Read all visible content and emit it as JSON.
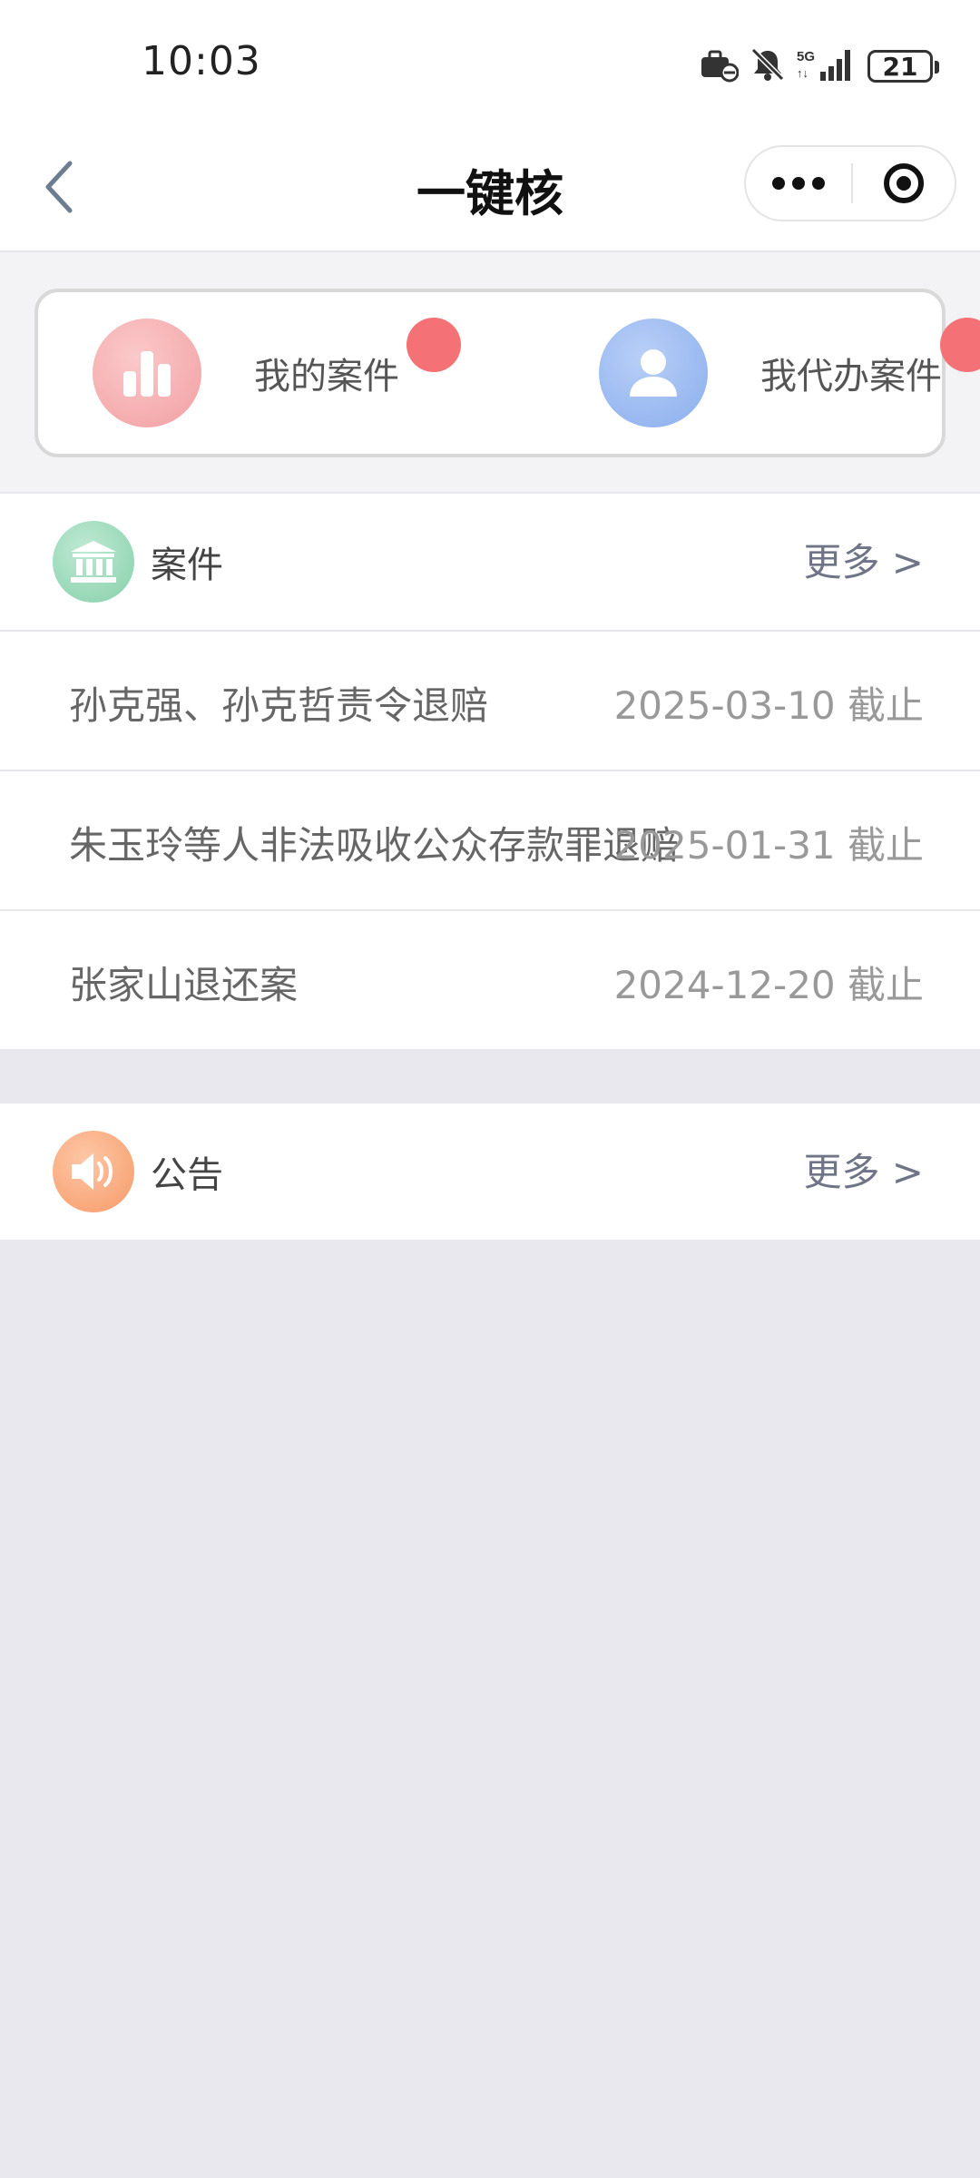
{
  "status": {
    "time": "10:03",
    "battery": "21"
  },
  "nav": {
    "title": "一键核"
  },
  "quick": [
    {
      "label": "我的案件",
      "color": "#f2a4a6"
    },
    {
      "label": "我代办案件",
      "color": "#8eb1ee"
    }
  ],
  "cases": {
    "title": "案件",
    "more": "更多 >",
    "items": [
      {
        "title": "孙克强、孙克哲责令退赔",
        "date": "2025-03-10 截止"
      },
      {
        "title": "朱玉玲等人非法吸收公众存款罪退赔",
        "date": "2025-01-31 截止"
      },
      {
        "title": "张家山退还案",
        "date": "2024-12-20 截止"
      }
    ]
  },
  "notices": {
    "title": "公告",
    "more": "更多 >"
  },
  "colors": {
    "badge": "#f47276",
    "case_icon": "#8fd3b0",
    "notice_icon": "#f9a77a",
    "page_bg": "#e9e8ee"
  },
  "icons": [
    "back-chevron-icon",
    "more-dots-icon",
    "target-icon",
    "bar-chart-icon",
    "person-icon",
    "bank-icon",
    "speaker-icon"
  ]
}
